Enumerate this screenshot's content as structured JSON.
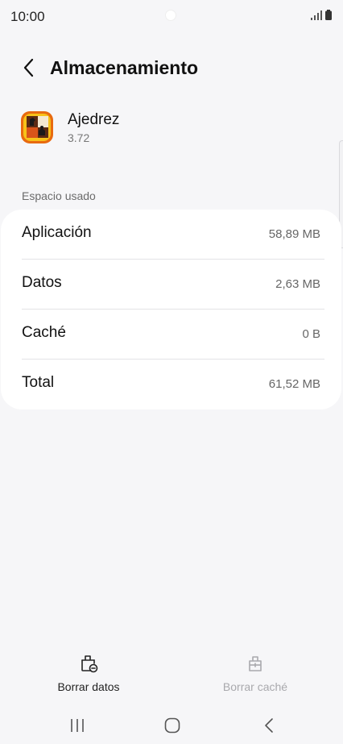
{
  "status_bar": {
    "time": "10:00"
  },
  "header": {
    "title": "Almacenamiento"
  },
  "app": {
    "name": "Ajedrez",
    "version": "3.72"
  },
  "section": {
    "label": "Espacio usado"
  },
  "storage_rows": [
    {
      "label": "Aplicación",
      "value": "58,89 MB"
    },
    {
      "label": "Datos",
      "value": "2,63 MB"
    },
    {
      "label": "Caché",
      "value": "0 B"
    },
    {
      "label": "Total",
      "value": "61,52 MB"
    }
  ],
  "actions": {
    "clear_data": "Borrar datos",
    "clear_cache": "Borrar caché"
  },
  "colors": {
    "background": "#f6f6f8",
    "card": "#ffffff",
    "disabled_text": "#a9a9ad"
  }
}
